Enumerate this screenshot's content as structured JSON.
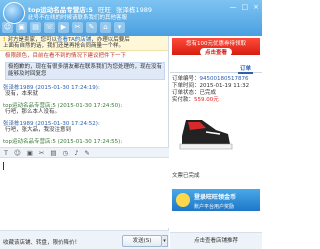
{
  "window": {
    "shop_name": "top运动名品专营店:5",
    "status": "旺旺 ",
    "account": "张泽栋1989",
    "subtitle": "此号不在线的时候请联系我们的其他客服"
  },
  "window_controls": [
    "—",
    "□",
    "×"
  ],
  "toolbar_icons": [
    "smile-icon",
    "image-icon",
    "folder-icon",
    "call-icon",
    "video-icon",
    "screenshot-icon",
    "edit-icon",
    "shop-icon",
    "dropdown-icon"
  ],
  "notice": {
    "prefix": "对方是卖家，您可以",
    "link": "查看TA的店铺",
    "suffix": "，办理以后要后",
    "line2": "上面有自然的话，我们还是再抢合同商量一个样。"
  },
  "messages": [
    {
      "kind": "text",
      "text": "极限颜色，目前在看不到的情况下建议把件下一下"
    },
    {
      "kind": "highlight",
      "text": "极抱歉的，现在有很多朋友都在联系我们为您处理的，现在没有能够及时回复您"
    },
    {
      "kind": "meta",
      "text": "张泽栋1989 (2015-01-30 17:24:19):",
      "mine": true
    },
    {
      "kind": "text",
      "text": "没有，本来就"
    },
    {
      "kind": "meta",
      "text": "top运动名品专营店:5 (2015-01-30 17:24:50):"
    },
    {
      "kind": "text",
      "text": "行吧，那么本人没有。"
    },
    {
      "kind": "meta",
      "text": "张泽栋1989 (2015-01-30 17:24:52):",
      "mine": true
    },
    {
      "kind": "text",
      "text": "行吧，张大品，我没注意到"
    },
    {
      "kind": "meta",
      "text": "top运动名品专营店:5 (2015-01-30 17:24:55):"
    },
    {
      "kind": "emoji"
    }
  ],
  "input_toolbar": [
    "T",
    "☺",
    "▣",
    "✂",
    "▤",
    "◷",
    "♪",
    "✎"
  ],
  "bottom": {
    "ad": "收藏该店铺、转盘，限价降价！",
    "send": "发送(S)",
    "send_arrow": "▾"
  },
  "side": {
    "banner_line1": "您有100元优惠券待领取",
    "banner_btn": "点击查看",
    "tab": "订单",
    "order_no_label": "订单编号：",
    "order_no": "94500180517876",
    "date_label": "下单时间：",
    "date": "2015-01-19 11:32",
    "status_label": "订单状态：",
    "status": "已完成",
    "price_label": "实付款：",
    "price": "559.00元",
    "desc": "文票已完成",
    "promo_title": "登录旺旺领金币",
    "promo_sub": "账户平台用户奖励",
    "bottom_link": "点击查看店铺推荐"
  },
  "colors": {
    "title": "#4a9fe0",
    "accent": "#2b5fb0",
    "price": "#e02020",
    "promo": "#1e77c8"
  }
}
